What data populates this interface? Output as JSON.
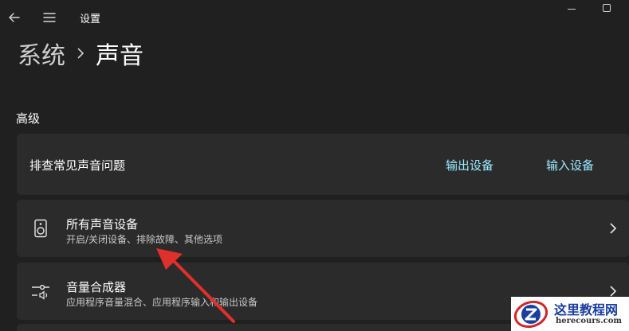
{
  "window": {
    "title": "设置"
  },
  "breadcrumb": {
    "parent": "系统",
    "current": "声音"
  },
  "section": {
    "title": "高级"
  },
  "troubleshoot": {
    "label": "排查常见声音问题",
    "output_link": "输出设备",
    "input_link": "输入设备"
  },
  "rows": [
    {
      "title": "所有声音设备",
      "subtitle": "开启/关闭设备、排除故障、其他选项",
      "icon": "speaker-icon"
    },
    {
      "title": "音量合成器",
      "subtitle": "应用程序音量混合、应用程序输入和输出设备",
      "icon": "mixer-icon"
    }
  ],
  "watermark": {
    "name": "这里教程网",
    "url": "herecours.com"
  },
  "colors": {
    "background": "#202020",
    "card": "#2b2b2b",
    "accent_link": "#99ebff",
    "arrow": "#e0302b"
  }
}
